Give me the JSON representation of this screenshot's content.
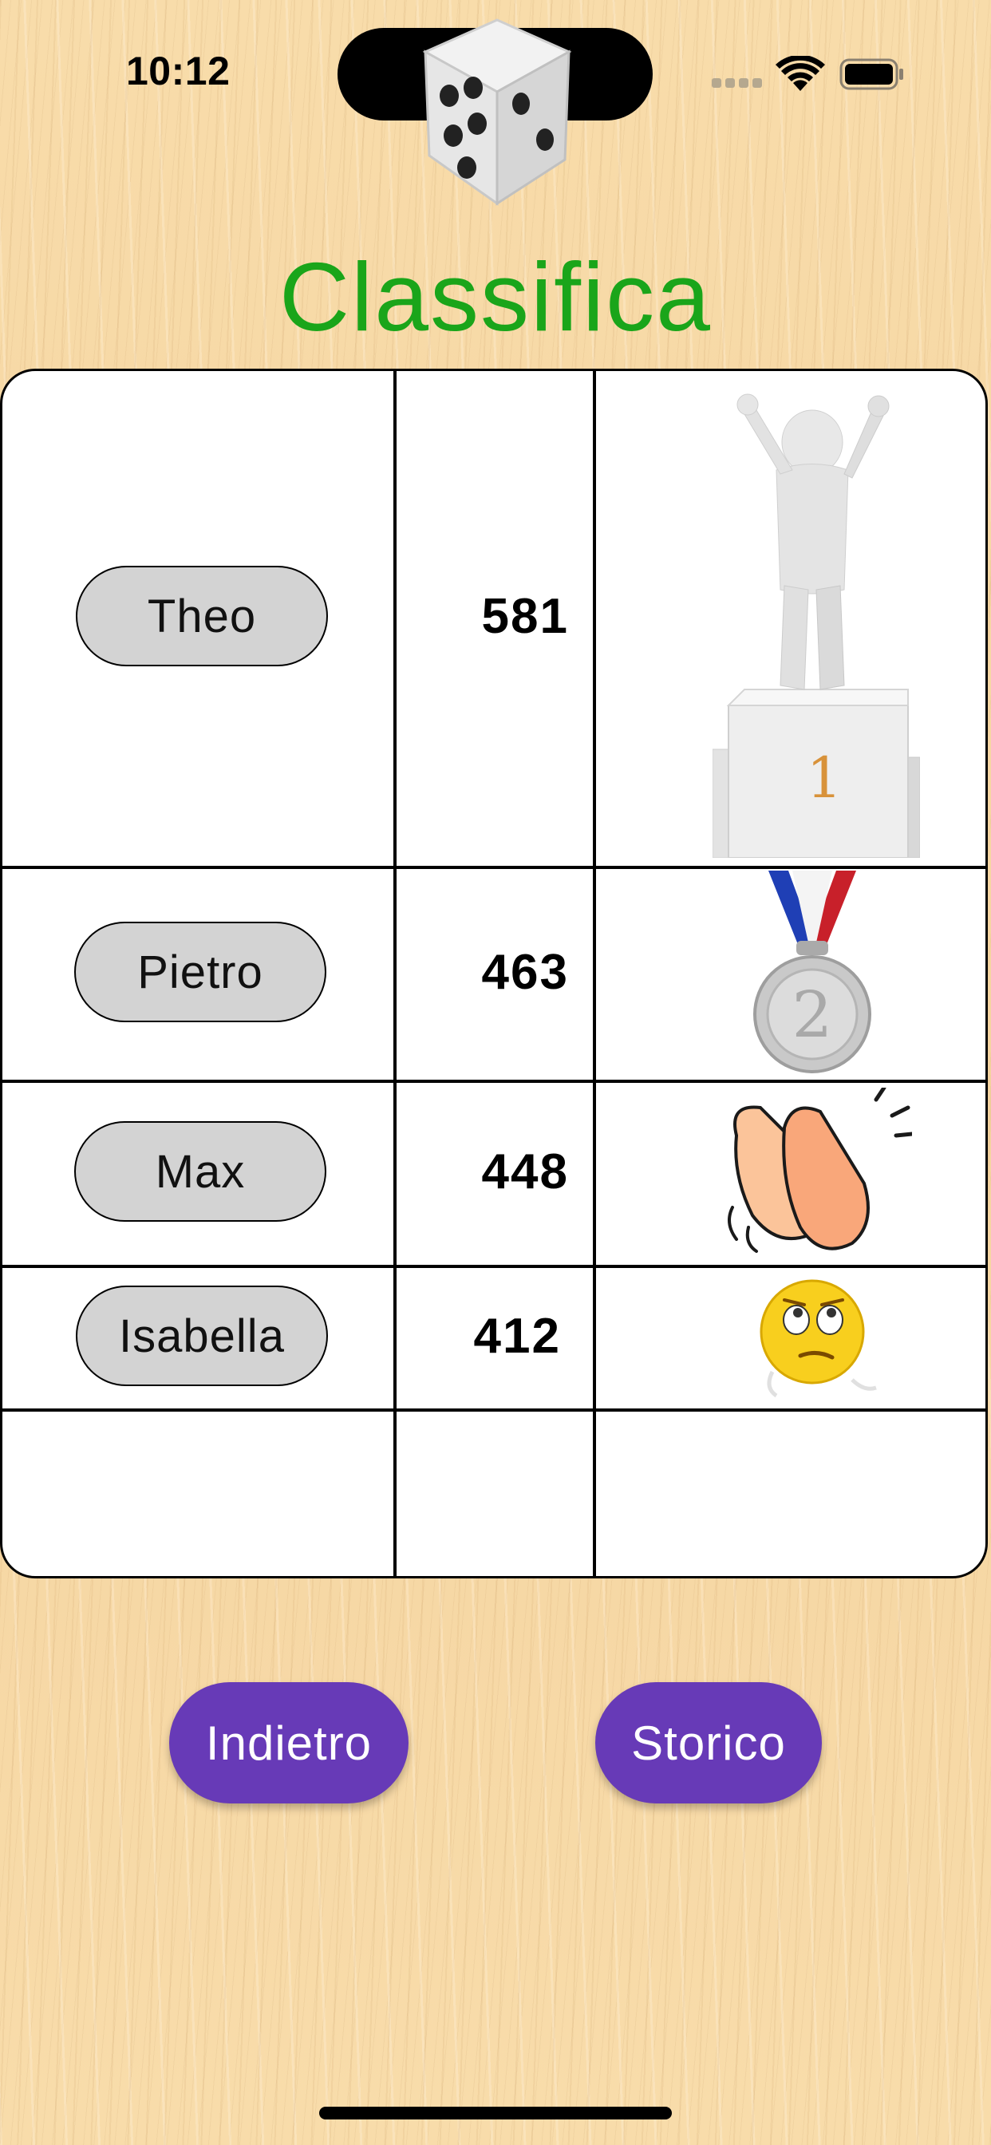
{
  "status_bar": {
    "time": "10:12"
  },
  "header": {
    "title": "Classifica"
  },
  "leaderboard": {
    "rows": [
      {
        "name": "Theo",
        "score": "581",
        "image": "podium-first-place-icon"
      },
      {
        "name": "Pietro",
        "score": "463",
        "image": "silver-medal-icon"
      },
      {
        "name": "Max",
        "score": "448",
        "image": "clapping-hands-icon"
      },
      {
        "name": "Isabella",
        "score": "412",
        "image": "sad-face-icon"
      }
    ]
  },
  "buttons": {
    "back": "Indietro",
    "history": "Storico"
  },
  "colors": {
    "title": "#1aa51a",
    "button": "#673ab7",
    "pill": "#d3d3d3",
    "background": "#f7d9a6"
  },
  "icons": [
    "dice-icon",
    "signal-icon",
    "wifi-icon",
    "battery-icon"
  ]
}
